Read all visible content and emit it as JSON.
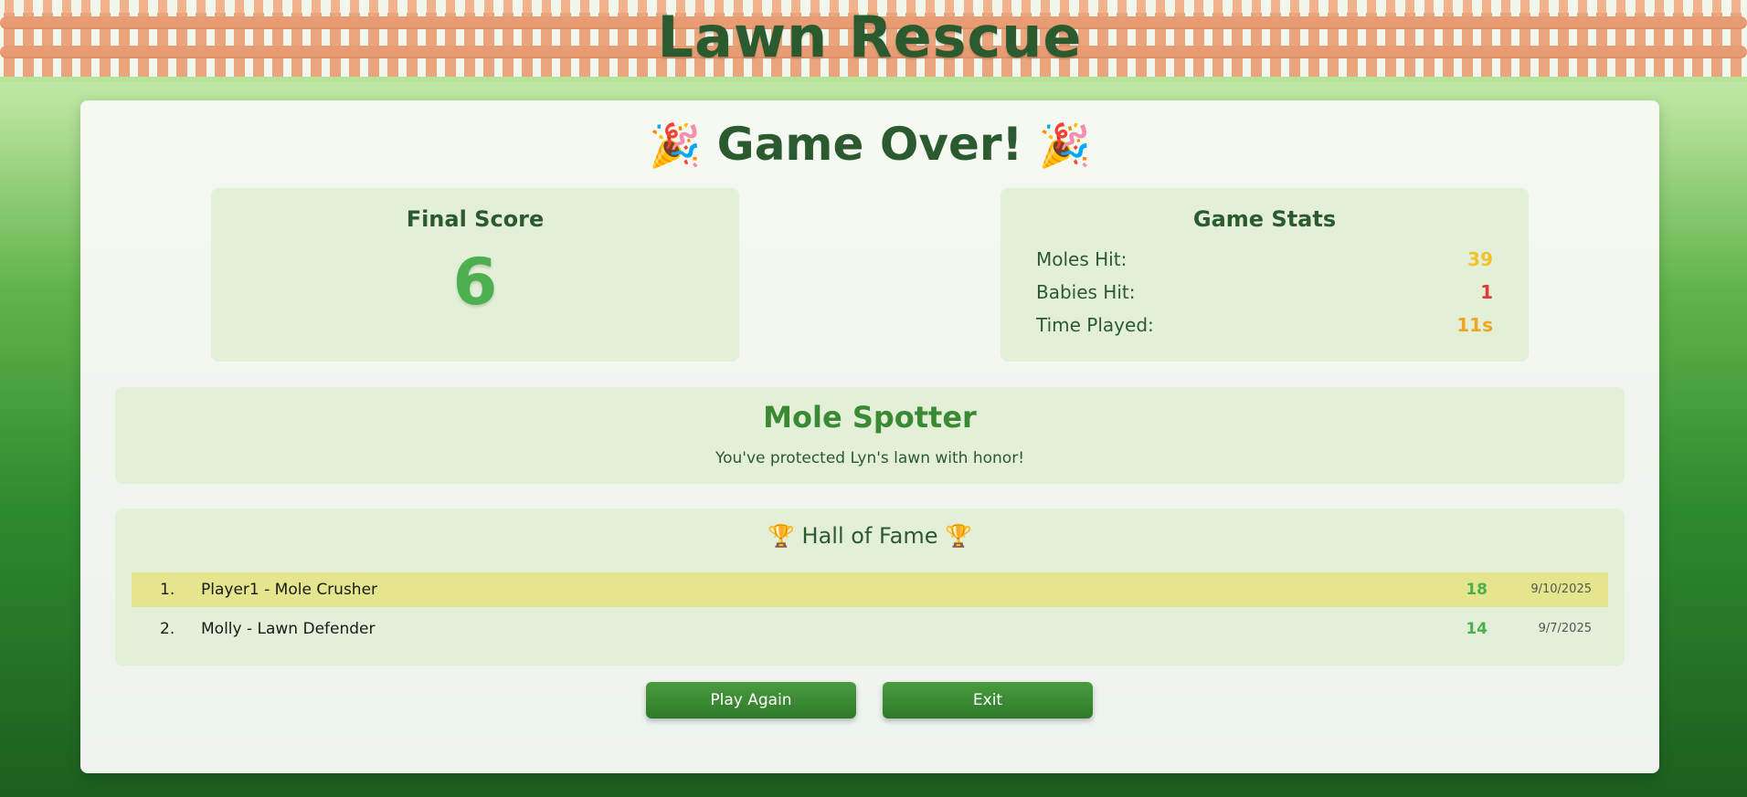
{
  "header": {
    "title": "Lawn Rescue"
  },
  "game_over": {
    "title": "Game Over!",
    "emoji_left": "🎉",
    "emoji_right": "🎉"
  },
  "final_score": {
    "label": "Final Score",
    "value": "6"
  },
  "game_stats": {
    "title": "Game Stats",
    "rows": [
      {
        "label": "Moles Hit:",
        "value": "39",
        "color": "#f2c12e"
      },
      {
        "label": "Babies Hit:",
        "value": "1",
        "color": "#e53935"
      },
      {
        "label": "Time Played:",
        "value": "11s",
        "color": "#f0a520"
      }
    ]
  },
  "rank": {
    "title": "Mole Spotter",
    "subtitle": "You've protected Lyn's lawn with honor!"
  },
  "hall_of_fame": {
    "title": "Hall of Fame",
    "trophy_icon": "🏆",
    "entries": [
      {
        "rank": "1.",
        "name": "Player1 - Mole Crusher",
        "score": "18",
        "date": "9/10/2025"
      },
      {
        "rank": "2.",
        "name": "Molly - Lawn Defender",
        "score": "14",
        "date": "9/7/2025"
      }
    ]
  },
  "buttons": {
    "play_again": "Play Again",
    "exit": "Exit"
  },
  "colors": {
    "accent": "#4caf50",
    "primary_text": "#2b5a30",
    "highlight_row": "#e5e58d"
  }
}
